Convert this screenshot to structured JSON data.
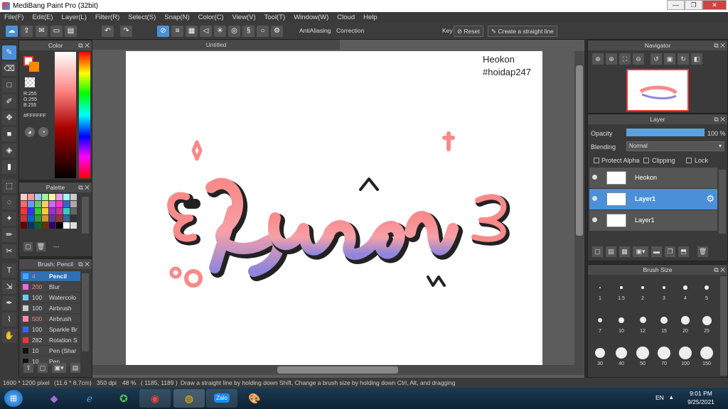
{
  "app": {
    "title": "MediBang Paint Pro (32bit)"
  },
  "menu": [
    "File(F)",
    "Edit(E)",
    "Layer(L)",
    "Filter(R)",
    "Select(S)",
    "Snap(N)",
    "Color(C)",
    "View(V)",
    "Tool(T)",
    "Window(W)",
    "Cloud",
    "Help"
  ],
  "toolbar": {
    "antialiasing": "AntiAliasing",
    "correction_label": "Correction",
    "correction_value": "40",
    "key_label": "Key",
    "reset_label": "Reset",
    "straight_label": "Create a straight line"
  },
  "color_panel": {
    "title": "Color",
    "r": "R:255",
    "g": "G:255",
    "b": "B:255",
    "hex": "#FFFFFF"
  },
  "palette_panel": {
    "title": "Palette",
    "dashes": "---"
  },
  "brush_panel": {
    "title": "Brush: Pencil",
    "items": [
      {
        "size": "4",
        "name": "Pencil",
        "color": "#4aa3ff"
      },
      {
        "size": "200",
        "name": "Blur",
        "color": "#e6e"
      },
      {
        "size": "100",
        "name": "Watercolo",
        "color": "#6cf"
      },
      {
        "size": "100",
        "name": "Airbrush",
        "color": "#ccc"
      },
      {
        "size": "500",
        "name": "Airbrush",
        "color": "#f8a"
      },
      {
        "size": "100",
        "name": "Sparkle Br",
        "color": "#36f"
      },
      {
        "size": "282",
        "name": "Rotation S",
        "color": "#e33"
      },
      {
        "size": "10",
        "name": "Pen (Shar",
        "color": "#111"
      },
      {
        "size": "10",
        "name": "Pen",
        "color": "#111"
      }
    ]
  },
  "document": {
    "tab": "Untitled",
    "text1": "Heokon",
    "text2": "#hoidap247",
    "art_text": "Buồn"
  },
  "navigator": {
    "title": "Navigator"
  },
  "layer_panel": {
    "title": "Layer",
    "opacity_label": "Opacity",
    "opacity_value": "100 %",
    "opacity_fraction": 1.0,
    "blending_label": "Blending",
    "blending_value": "Normal",
    "protect_alpha": "Protect Alpha",
    "clipping": "Clipping",
    "lock": "Lock",
    "layers": [
      {
        "name": "Heokon",
        "selected": false
      },
      {
        "name": "Layer1",
        "selected": true
      },
      {
        "name": "Layer1",
        "selected": false
      }
    ]
  },
  "brush_size": {
    "title": "Brush Size",
    "sizes": [
      "1",
      "1.5",
      "2",
      "3",
      "4",
      "5",
      "7",
      "10",
      "12",
      "15",
      "20",
      "25",
      "30",
      "40",
      "50",
      "70",
      "100",
      "150"
    ]
  },
  "status": {
    "dims": "1600 * 1200 pixel",
    "cm": "(11.6 * 8.7cm)",
    "dpi": "350 dpi",
    "zoom": "48 %",
    "coords": "( 1185, 1189 )",
    "hint": "Draw a straight line by holding down Shift, Change a brush size by holding down Ctrl, Alt, and dragging"
  },
  "taskbar": {
    "lang": "EN",
    "time": "9:01 PM",
    "date": "9/25/2021",
    "zalo": "Zalo"
  }
}
